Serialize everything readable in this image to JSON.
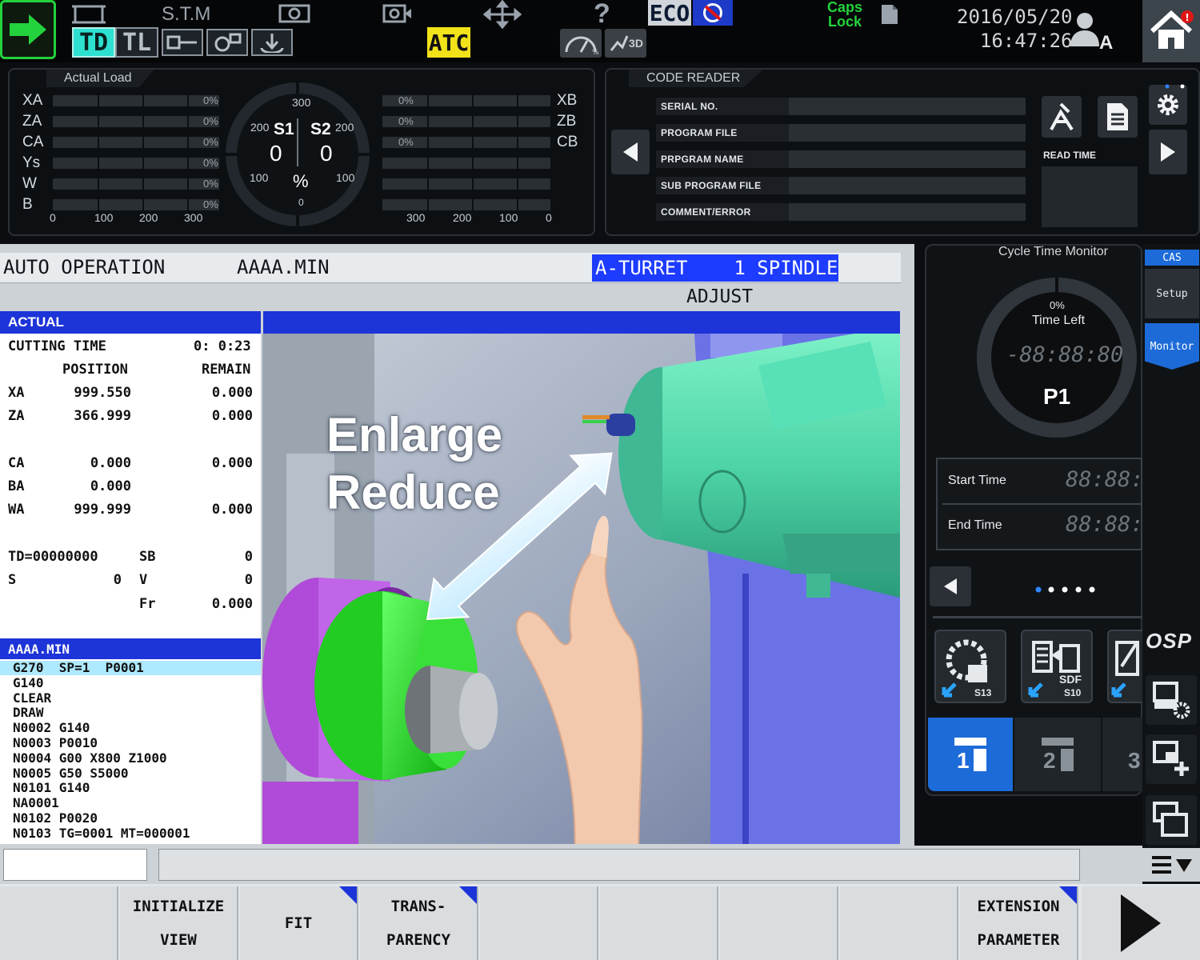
{
  "topbar": {
    "stm": "S.T.M",
    "td": "TD",
    "tl": "TL",
    "atc": "ATC",
    "eco": "ECO",
    "help": "?",
    "gauge_3d": "3D",
    "caps_lock": "Caps\nLock",
    "date": "2016/05/20",
    "time": "16:47:26",
    "user": "A",
    "accent_green": "#23d23c",
    "atc_color": "#f2e21a"
  },
  "actual_load": {
    "title": "Actual Load",
    "left_axes": [
      {
        "label": "XA",
        "pct": "0%"
      },
      {
        "label": "ZA",
        "pct": "0%"
      },
      {
        "label": "CA",
        "pct": "0%"
      },
      {
        "label": "Ys",
        "pct": "0%"
      },
      {
        "label": "W",
        "pct": "0%"
      },
      {
        "label": "B",
        "pct": "0%"
      }
    ],
    "right_axes": [
      {
        "label": "XB",
        "pct": "0%"
      },
      {
        "label": "ZB",
        "pct": "0%"
      },
      {
        "label": "CB",
        "pct": "0%"
      }
    ],
    "left_scale": [
      "0",
      "100",
      "200",
      "300"
    ],
    "right_scale": [
      "300",
      "200",
      "100",
      "0"
    ],
    "spindle": {
      "s1": "S1",
      "s2": "S2",
      "s1_value": "0",
      "s2_value": "0",
      "top": "300",
      "l200": "200",
      "r200": "200",
      "l100": "100",
      "r100": "100",
      "bottom": "0",
      "unit": "%"
    }
  },
  "code_reader": {
    "title": "CODE READER",
    "fields": [
      "SERIAL NO.",
      "PROGRAM FILE",
      "PRPGRAM NAME",
      "SUB PROGRAM FILE",
      "COMMENT/ERROR"
    ],
    "read_time": "READ TIME"
  },
  "main": {
    "mode": "AUTO OPERATION",
    "file": "AAAA.MIN",
    "turret": "A-TURRET    1 SPINDLE",
    "adjust": "ADJUST",
    "actual_header": "ACTUAL",
    "cutting_time_label": "CUTTING TIME",
    "cutting_time": "0: 0:23",
    "position_header": "POSITION",
    "remain_header": "REMAIN",
    "axes": [
      {
        "name": "XA",
        "pos": "999.550",
        "remain": "0.000"
      },
      {
        "name": "ZA",
        "pos": "366.999",
        "remain": "0.000"
      },
      {
        "name": "CA",
        "pos": "0.000",
        "remain": "0.000"
      },
      {
        "name": "BA",
        "pos": "0.000",
        "remain": ""
      },
      {
        "name": "WA",
        "pos": "999.999",
        "remain": "0.000"
      }
    ],
    "td": "TD=00000000",
    "sb_label": "SB",
    "sb": "0",
    "s_label": "S",
    "s": "0",
    "v_label": "V",
    "v": "0",
    "fr_label": "Fr",
    "fr": "0.000",
    "program_header": "AAAA.MIN",
    "program_lines": [
      "G270  SP=1  P0001",
      "G140",
      "CLEAR",
      "DRAW",
      "N0002 G140",
      "N0003 P0010",
      "N0004 G00 X800 Z1000",
      "N0005 G50 S5000",
      "N0101 G140",
      "NA0001",
      "N0102 P0020",
      "N0103 TG=0001 MT=000001"
    ],
    "overlay_line1": "Enlarge",
    "overlay_line2": "Reduce"
  },
  "cycle_time": {
    "title": "Cycle Time Monitor",
    "percent": "0%",
    "time_left_label": "Time Left",
    "time_left": "-88:88:80",
    "program": "P1",
    "start_label": "Start Time",
    "start_value": "88:88:",
    "end_label": "End Time",
    "end_value": "88:88:",
    "tool_s13": "S13",
    "tool_s10": "S10",
    "sdf": "SDF",
    "tab1": "1",
    "tab2": "2",
    "tab3": "3"
  },
  "sidebar": {
    "cas": "CAS",
    "setup": "Setup",
    "monitor": "Monitor",
    "osp": "OSP"
  },
  "fkeys": [
    {
      "l1": "",
      "l2": ""
    },
    {
      "l1": "INITIALIZE",
      "l2": "VIEW"
    },
    {
      "l1": "FIT",
      "l2": ""
    },
    {
      "l1": "TRANS-",
      "l2": "PARENCY"
    },
    {
      "l1": "",
      "l2": ""
    },
    {
      "l1": "",
      "l2": ""
    },
    {
      "l1": "",
      "l2": ""
    },
    {
      "l1": "",
      "l2": ""
    },
    {
      "l1": "EXTENSION",
      "l2": "PARAMETER"
    }
  ]
}
